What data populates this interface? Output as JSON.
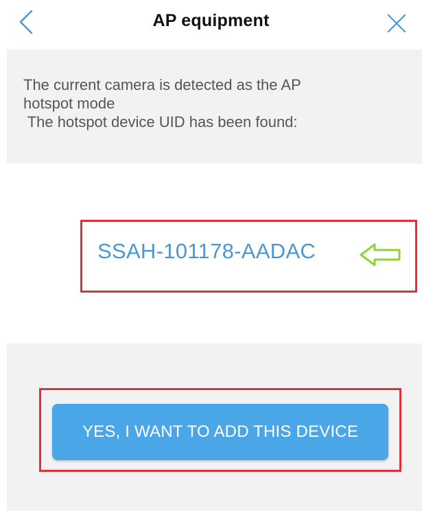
{
  "header": {
    "title": "AP equipment",
    "back_icon": "chevron-left-icon",
    "close_icon": "close-icon"
  },
  "info": {
    "lines": [
      "The current camera is detected as the AP",
      "hotspot mode",
      " The hotspot device UID has been found:"
    ]
  },
  "device": {
    "uid": "SSAH-101178-AADAC",
    "indicator_icon": "arrow-left-outline-icon"
  },
  "actions": {
    "confirm_label": "YES, I WANT TO ADD THIS DEVICE"
  },
  "colors": {
    "accent": "#4aa6e6",
    "uid_text": "#4a97d6",
    "highlight_border": "#e0303a",
    "arrow": "#8fd13a",
    "panel_bg": "#f2f2f2"
  }
}
